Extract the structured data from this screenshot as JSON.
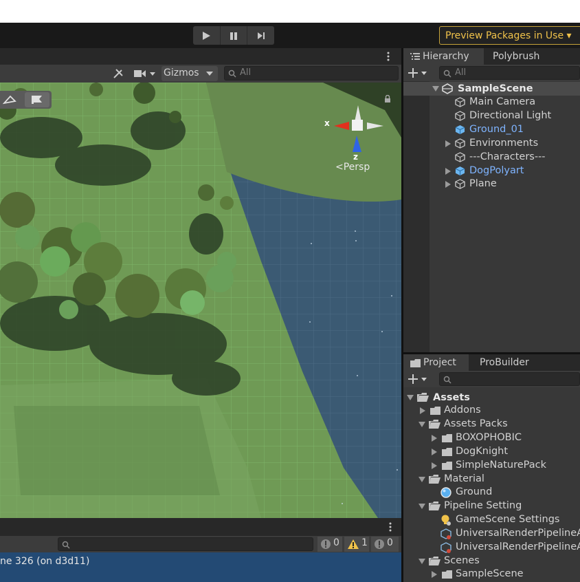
{
  "toolbar": {
    "play_icon": "play-icon",
    "pause_icon": "pause-icon",
    "step_icon": "step-icon",
    "preview_label": "Preview Packages in Use ▾"
  },
  "scene": {
    "draw_mode_icon": "tools-icon",
    "camera_icon": "camera-icon",
    "gizmos_label": "Gizmos",
    "search_placeholder": "All",
    "gizmo": {
      "x_label": "x",
      "z_label": "z",
      "persp_label": "<Persp"
    }
  },
  "console": {
    "message": "ne 326 (on d3d11)",
    "counts": {
      "info": "0",
      "warning": "1",
      "error": "0"
    }
  },
  "hierarchy": {
    "tabs": [
      "Hierarchy",
      "Polybrush"
    ],
    "search_placeholder": "All",
    "scene_name": "SampleScene",
    "items": [
      {
        "label": "Main Camera",
        "blue": false,
        "expandable": false
      },
      {
        "label": "Directional Light",
        "blue": false,
        "expandable": false
      },
      {
        "label": "Ground_01",
        "blue": true,
        "expandable": false
      },
      {
        "label": "Environments",
        "blue": false,
        "expandable": true
      },
      {
        "label": "---Characters---",
        "blue": false,
        "expandable": false
      },
      {
        "label": "DogPolyart",
        "blue": true,
        "expandable": true
      },
      {
        "label": "Plane",
        "blue": false,
        "expandable": true
      }
    ]
  },
  "project": {
    "tabs": [
      "Project",
      "ProBuilder"
    ],
    "tree": {
      "assets": "Assets",
      "addons": "Addons",
      "assets_packs": "Assets Packs",
      "boxophobic": "BOXOPHOBIC",
      "dogknight": "DogKnight",
      "simple_nature_pack": "SimpleNaturePack",
      "material": "Material",
      "ground": "Ground",
      "pipeline_setting": "Pipeline Setting",
      "game_scene_settings": "GameScene Settings",
      "urp_asset_1": "UniversalRenderPipelineA",
      "urp_asset_2": "UniversalRenderPipelineA",
      "scenes": "Scenes",
      "sample_scene": "SampleScene"
    }
  },
  "colors": {
    "accent_blue": "#7fb4ff",
    "preview_yellow": "#f0c24a",
    "console_selection": "#234a74",
    "terrain_green": "#6f9a55",
    "water_blue": "#3b5a73"
  }
}
